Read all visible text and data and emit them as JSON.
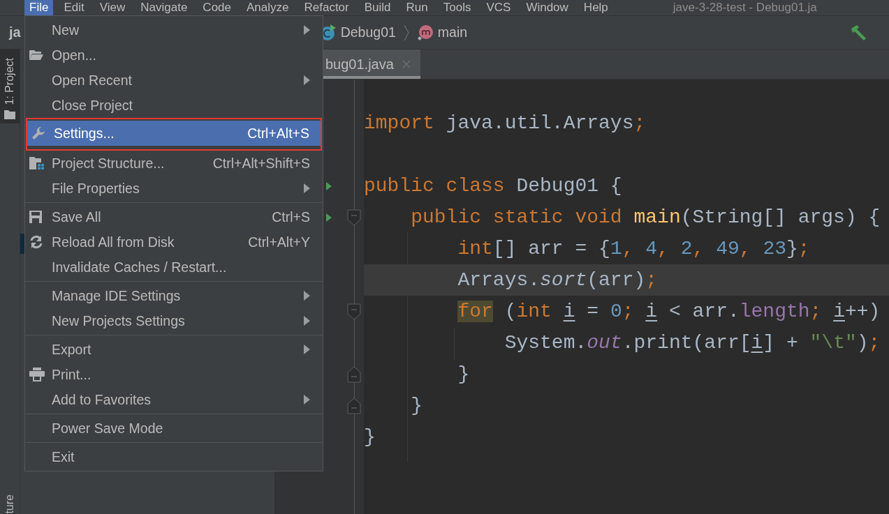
{
  "menu_bar": {
    "items": [
      {
        "label": "File",
        "selected": true
      },
      {
        "label": "Edit",
        "selected": false
      },
      {
        "label": "View",
        "selected": false
      },
      {
        "label": "Navigate",
        "selected": false
      },
      {
        "label": "Code",
        "selected": false
      },
      {
        "label": "Analyze",
        "selected": false
      },
      {
        "label": "Refactor",
        "selected": false
      },
      {
        "label": "Build",
        "selected": false
      },
      {
        "label": "Run",
        "selected": false
      },
      {
        "label": "Tools",
        "selected": false
      },
      {
        "label": "VCS",
        "selected": false
      },
      {
        "label": "Window",
        "selected": false
      },
      {
        "label": "Help",
        "selected": false
      }
    ],
    "title": "jave-3-28-test - Debug01.ja"
  },
  "navigation_bar": {
    "project": "ja",
    "breadcrumbs": [
      {
        "kind": "class",
        "label": "Debug01"
      },
      {
        "kind": "method",
        "label": "main"
      }
    ]
  },
  "tool_strip": {
    "top_tab": "1: Project",
    "bottom_tab": "ture"
  },
  "editor_tabs": [
    {
      "label": "bug01.java",
      "selected": true
    }
  ],
  "file_menu": {
    "sections": [
      [
        {
          "label": "New",
          "submenu": true,
          "selected": false,
          "annotated": false
        },
        {
          "label": "Open...",
          "submenu": false,
          "selected": false,
          "annotated": false
        },
        {
          "label": "Open Recent",
          "submenu": true,
          "selected": false,
          "annotated": false
        },
        {
          "label": "Close Project",
          "submenu": false,
          "selected": false,
          "annotated": false
        },
        {
          "label": "Settings...",
          "shortcut": "Ctrl+Alt+S",
          "submenu": false,
          "selected": true,
          "annotated": true
        },
        {
          "label": "Project Structure...",
          "shortcut": "Ctrl+Alt+Shift+S",
          "submenu": false,
          "selected": false,
          "annotated": false
        },
        {
          "label": "File Properties",
          "submenu": true,
          "selected": false,
          "annotated": false
        }
      ],
      [
        {
          "label": "Save All",
          "shortcut": "Ctrl+S",
          "submenu": false,
          "selected": false,
          "annotated": false
        },
        {
          "label": "Reload All from Disk",
          "shortcut": "Ctrl+Alt+Y",
          "submenu": false,
          "selected": false,
          "annotated": false
        },
        {
          "label": "Invalidate Caches / Restart...",
          "submenu": false,
          "selected": false,
          "annotated": false
        }
      ],
      [
        {
          "label": "Manage IDE Settings",
          "submenu": true,
          "selected": false,
          "annotated": false
        },
        {
          "label": "New Projects Settings",
          "submenu": true,
          "selected": false,
          "annotated": false
        }
      ],
      [
        {
          "label": "Export",
          "submenu": true,
          "selected": false,
          "annotated": false
        },
        {
          "label": "Print...",
          "submenu": false,
          "selected": false,
          "annotated": false
        },
        {
          "label": "Add to Favorites",
          "submenu": true,
          "selected": false,
          "annotated": false
        }
      ],
      [
        {
          "label": "Power Save Mode",
          "submenu": false,
          "selected": false,
          "annotated": false
        }
      ],
      [
        {
          "label": "Exit",
          "submenu": false,
          "selected": false,
          "annotated": false
        }
      ]
    ]
  },
  "code_lines": [
    {
      "run": false,
      "current": false,
      "fold_start": false,
      "fold_end": false,
      "tokens": [
        {
          "kind": "keyword",
          "text": "import"
        },
        {
          "kind": "plain",
          "text": " java.util.Arrays"
        },
        {
          "kind": "keyword",
          "text": ";"
        }
      ]
    },
    {
      "run": false,
      "current": false,
      "fold_start": false,
      "fold_end": false
    },
    {
      "run": true,
      "current": false,
      "fold_start": false,
      "fold_end": false,
      "tokens": [
        {
          "kind": "keyword",
          "text": "public class"
        },
        {
          "kind": "plain",
          "text": " Debug01 {"
        }
      ]
    },
    {
      "run": true,
      "current": false,
      "fold_start": true,
      "fold_end": false,
      "tokens": [
        {
          "kind": "keyword",
          "text": "    public static void"
        },
        {
          "kind": "function",
          "text": " main"
        },
        {
          "kind": "plain",
          "text": "(String[] args) {"
        }
      ]
    },
    {
      "run": false,
      "current": false,
      "fold_start": false,
      "fold_end": false,
      "tokens": [
        {
          "kind": "keyword",
          "text": "        int"
        },
        {
          "kind": "plain",
          "text": "[] arr = {"
        },
        {
          "kind": "number",
          "text": "1"
        },
        {
          "kind": "keyword",
          "text": ","
        },
        {
          "kind": "number",
          "text": " 4"
        },
        {
          "kind": "keyword",
          "text": ","
        },
        {
          "kind": "number",
          "text": " 2"
        },
        {
          "kind": "keyword",
          "text": ","
        },
        {
          "kind": "number",
          "text": " 49"
        },
        {
          "kind": "keyword",
          "text": ","
        },
        {
          "kind": "number",
          "text": " 23"
        },
        {
          "kind": "plain",
          "text": "}"
        },
        {
          "kind": "keyword",
          "text": ";"
        }
      ]
    },
    {
      "run": false,
      "current": true,
      "fold_start": false,
      "fold_end": false,
      "tokens": [
        {
          "kind": "plain",
          "text": "        Arrays."
        },
        {
          "kind": "italic",
          "text": "sort"
        },
        {
          "kind": "plain",
          "text": "(arr)"
        },
        {
          "kind": "keyword",
          "text": ";"
        }
      ]
    },
    {
      "run": false,
      "current": false,
      "fold_start": true,
      "fold_end": false,
      "tokens": [
        {
          "kind": "highlighted_keyword",
          "text": "        for"
        },
        {
          "kind": "plain",
          "text": " ("
        },
        {
          "kind": "keyword",
          "text": "int "
        },
        {
          "kind": "variable",
          "text": "i"
        },
        {
          "kind": "plain",
          "text": " = "
        },
        {
          "kind": "number",
          "text": "0"
        },
        {
          "kind": "keyword",
          "text": "; "
        },
        {
          "kind": "variable",
          "text": "i"
        },
        {
          "kind": "plain",
          "text": " < arr."
        },
        {
          "kind": "field",
          "text": "length"
        },
        {
          "kind": "keyword",
          "text": "; "
        },
        {
          "kind": "variable",
          "text": "i"
        },
        {
          "kind": "plain",
          "text": "++)"
        }
      ]
    },
    {
      "run": false,
      "current": false,
      "fold_start": false,
      "fold_end": false,
      "tokens": [
        {
          "kind": "plain",
          "text": "            System."
        },
        {
          "kind": "static_field",
          "text": "out"
        },
        {
          "kind": "plain",
          "text": ".print(arr["
        },
        {
          "kind": "variable",
          "text": "i"
        },
        {
          "kind": "plain",
          "text": "] + "
        },
        {
          "kind": "string",
          "text": "\"\\t\""
        },
        {
          "kind": "plain",
          "text": ")"
        },
        {
          "kind": "keyword",
          "text": ";"
        }
      ]
    },
    {
      "run": false,
      "current": false,
      "fold_start": false,
      "fold_end": true,
      "tokens": [
        {
          "kind": "plain",
          "text": "        }"
        }
      ]
    },
    {
      "run": false,
      "current": false,
      "fold_start": false,
      "fold_end": true,
      "tokens": [
        {
          "kind": "plain",
          "text": "    }"
        }
      ]
    },
    {
      "run": false,
      "current": false,
      "fold_start": false,
      "fold_end": false,
      "tokens": [
        {
          "kind": "plain",
          "text": "}"
        }
      ]
    }
  ]
}
